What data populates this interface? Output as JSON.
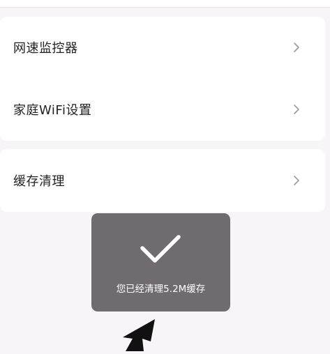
{
  "settings": {
    "items": [
      {
        "label": "网速监控器",
        "icon": "chevron-right-icon"
      },
      {
        "label": "家庭WiFi设置",
        "icon": "chevron-right-icon"
      },
      {
        "label": "缓存清理",
        "icon": "chevron-right-icon"
      }
    ]
  },
  "toast": {
    "icon": "checkmark-icon",
    "message": "您已经清理5.2M缓存"
  },
  "colors": {
    "background": "#f8f5f8",
    "card": "#ffffff",
    "toast_background": "#6f6b6e",
    "text_primary": "#222222",
    "chevron": "#9a9a9a"
  }
}
